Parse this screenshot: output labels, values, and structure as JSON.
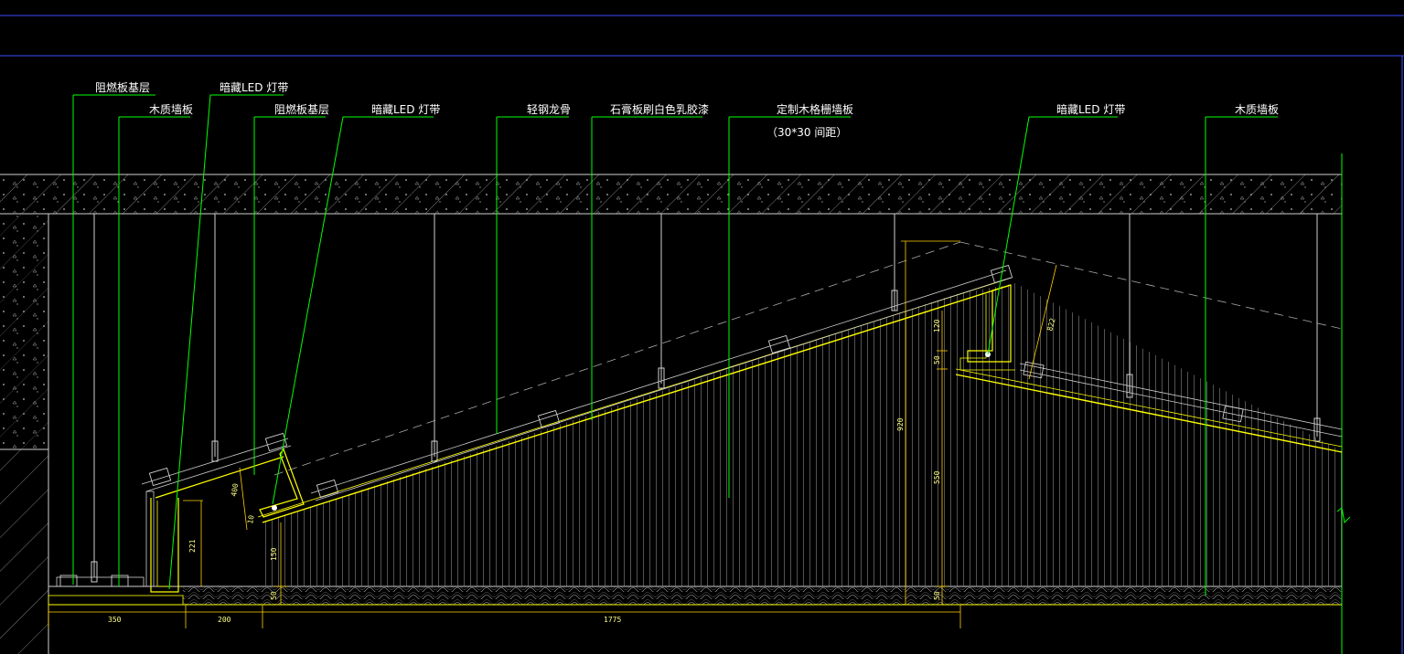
{
  "labels": {
    "flame_base_left": "阻燃板基层",
    "led_left_top": "暗藏LED 灯带",
    "wood_panel_left": "木质墙板",
    "flame_base_mid": "阻燃板基层",
    "led_mid": "暗藏LED 灯带",
    "steel_keel": "轻钢龙骨",
    "gypsum_paint": "石膏板刷白色乳胶漆",
    "wood_grille": "定制木格栅墙板",
    "wood_grille_spacing": "（30*30  间距）",
    "led_right": "暗藏LED 灯带",
    "wood_panel_right": "木质墙板"
  },
  "dimensions": {
    "bottom_350": "350",
    "bottom_200": "200",
    "bottom_1775": "1775",
    "left_221": "221",
    "left_150": "150",
    "left_50": "50",
    "left_400": "400",
    "left_10": "10",
    "right_920": "920",
    "right_120": "120",
    "right_50a": "50",
    "right_550": "550",
    "right_50b": "50",
    "right_diag_822": "822"
  },
  "colors": {
    "background": "#000000",
    "leader": "#00ff00",
    "outline": "#ffffff",
    "accent": "#ffff00",
    "dimension": "#ffd000",
    "frame": "#3a4cff",
    "hatch": "#cfcfcf",
    "grille": "#9a9a9a"
  }
}
